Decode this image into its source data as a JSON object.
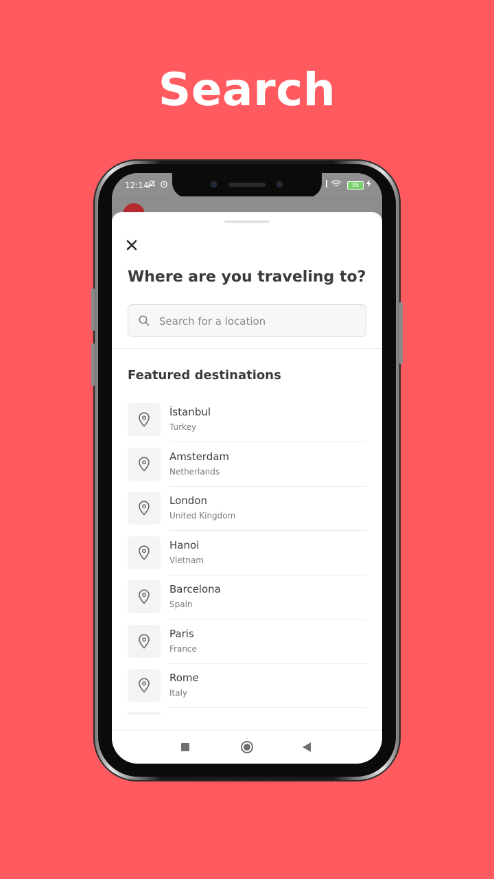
{
  "headline": "Search",
  "status_bar": {
    "time": "12:14",
    "battery": "95"
  },
  "sheet": {
    "title": "Where are you traveling to?",
    "search": {
      "placeholder": "Search for a location",
      "value": ""
    },
    "section_title": "Featured destinations",
    "destinations": [
      {
        "name": "İstanbul",
        "country": "Turkey"
      },
      {
        "name": "Amsterdam",
        "country": "Netherlands"
      },
      {
        "name": "London",
        "country": "United Kingdom"
      },
      {
        "name": "Hanoi",
        "country": "Vietnam"
      },
      {
        "name": "Barcelona",
        "country": "Spain"
      },
      {
        "name": "Paris",
        "country": "France"
      },
      {
        "name": "Rome",
        "country": "Italy"
      }
    ]
  },
  "colors": {
    "background": "#FF5A5F",
    "text_dark": "#3a3a3a",
    "text_muted": "#7a7a7a"
  },
  "icons": {
    "close": "close-icon",
    "search": "search-icon",
    "location": "location-pin-icon"
  }
}
